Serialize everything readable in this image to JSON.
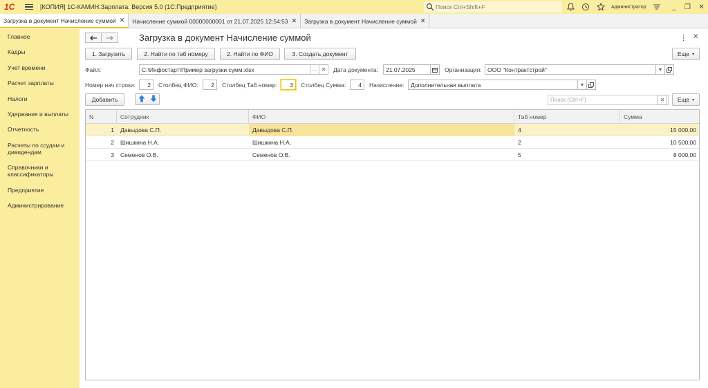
{
  "titlebar": {
    "logo": "1С",
    "title": "[КОПИЯ] 1С-КАМИН:Зарплата. Версия 5.0  (1С:Предприятие)",
    "search_placeholder": "Поиск Ctrl+Shift+F",
    "user": "Администратор"
  },
  "tabs": [
    {
      "label": "Загрузка в документ Начисление суммой",
      "active": true
    },
    {
      "label": "Начисление суммой 00000000001 от 21.07.2025 12:54:53",
      "active": false
    },
    {
      "label": "Загрузка в документ Начисление суммой",
      "active": false
    }
  ],
  "sidebar": {
    "items": [
      {
        "label": "Главное"
      },
      {
        "label": "Кадры"
      },
      {
        "label": "Учет времени"
      },
      {
        "label": "Расчет зарплаты"
      },
      {
        "label": "Налоги"
      },
      {
        "label": "Удержания и выплаты"
      },
      {
        "label": "Отчетность"
      },
      {
        "label": "Расчеты по ссудам и дивидендам"
      },
      {
        "label": "Справочники и классификаторы"
      },
      {
        "label": "Предприятие"
      },
      {
        "label": "Администрирование"
      }
    ]
  },
  "form": {
    "title": "Загрузка в документ Начисление суммой",
    "commands": {
      "load": "1. Загрузить",
      "find_tab": "2. Найти по таб номеру",
      "find_fio": "2. Найти по ФИО",
      "create_doc": "3. Создать документ",
      "more": "Еще"
    },
    "file_label": "Файл:",
    "file_value": "C:\\Инфостарт\\Пример загрузки сумм.xlsx",
    "date_label": "Дата документа:",
    "date_value": "21.07.2025",
    "org_label": "Организация:",
    "org_value": "ООО \"Контрактстрой\"",
    "start_row_label": "Номер нач строки:",
    "start_row_value": "2",
    "col_fio_label": "Столбец ФИО:",
    "col_fio_value": "2",
    "col_tab_label": "Столбец Таб номер:",
    "col_tab_value": "3",
    "col_sum_label": "Столбец Сумма:",
    "col_sum_value": "4",
    "accrual_label": "Начисление:",
    "accrual_value": "Дополнительная выплата",
    "add_button": "Добавить",
    "table_search_placeholder": "Поиск (Ctrl+F)",
    "table_more": "Еще"
  },
  "table": {
    "columns": [
      "N",
      "Сотрудник",
      "ФИО",
      "Таб номер",
      "Сумма"
    ],
    "rows": [
      {
        "n": "1",
        "employee": "Давыдова С.П.",
        "fio": "Давыдова С.П.",
        "tab": "4",
        "sum": "15 000,00"
      },
      {
        "n": "2",
        "employee": "Шишкина Н.А.",
        "fio": "Шишкина Н.А.",
        "tab": "2",
        "sum": "10 500,00"
      },
      {
        "n": "3",
        "employee": "Семенов О.В.",
        "fio": "Семенов О.В.",
        "tab": "5",
        "sum": "8 000,00"
      }
    ]
  },
  "colors": {
    "accent_yellow": "#fbed9e",
    "selected_row": "#fbf1c6",
    "current_cell": "#f7e39a",
    "logo_red": "#d32f1f",
    "arrow_blue": "#2f7fd6"
  }
}
